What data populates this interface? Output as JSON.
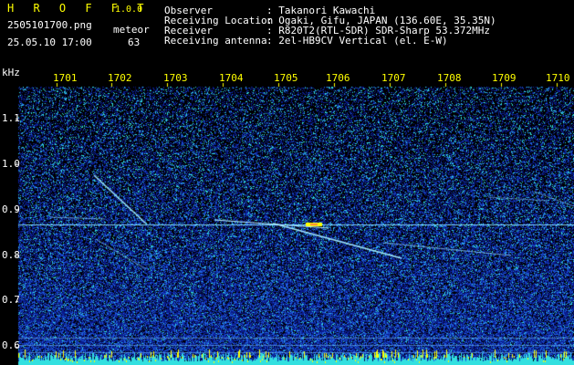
{
  "header": {
    "app_name": "H R O F F T",
    "version": "1.0.0",
    "file_name": "2505101700.png",
    "datetime": "25.05.10 17:00",
    "detector_label": "meteor",
    "detector_count": "63",
    "info": [
      {
        "label": "Observer",
        "value": ": Takanori Kawachi"
      },
      {
        "label": "Receiving Location",
        "value": ": Ogaki, Gifu, JAPAN (136.60E, 35.35N)"
      },
      {
        "label": "Receiver",
        "value": ": R820T2(RTL-SDR) SDR-Sharp 53.372MHz"
      },
      {
        "label": "Receiving antenna",
        "value": ": 2el-HB9CV Vertical (el. E-W)"
      }
    ]
  },
  "spectrogram": {
    "y_unit": "kHz",
    "y_ticks": [
      "1.1",
      "1.0",
      "0.9",
      "0.8",
      "0.7",
      "0.6"
    ],
    "x_ticks": [
      "1701",
      "1702",
      "1703",
      "1704",
      "1705",
      "1706",
      "1707",
      "1708",
      "1709",
      "1710"
    ],
    "colors": {
      "background": "#000000",
      "noise_low": "#0a1a8a",
      "noise_mid": "#1f5fe0",
      "noise_high": "#33e0e0",
      "echo": "#9fe8ff",
      "peak": "#ffff00",
      "carrier": "#7fd8ff"
    }
  }
}
